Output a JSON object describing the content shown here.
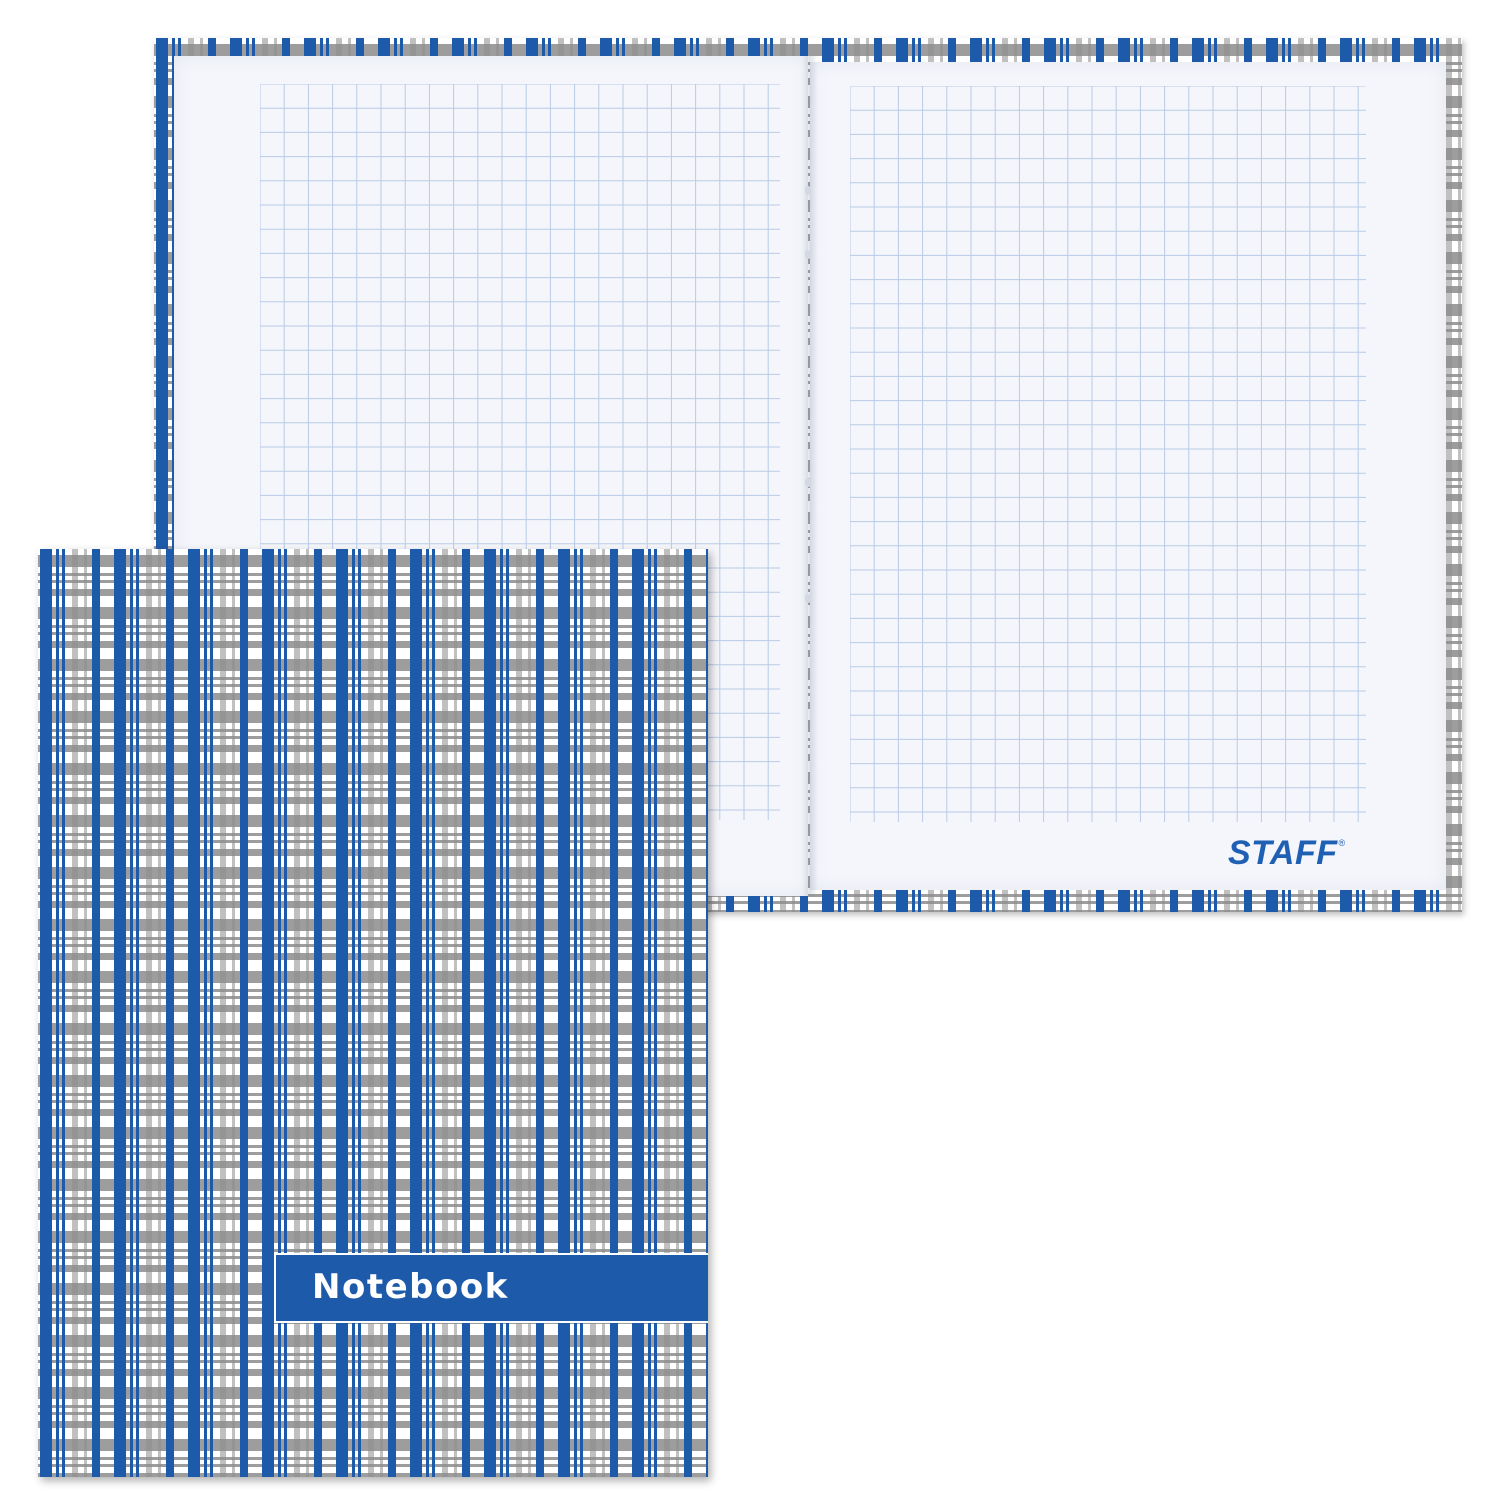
{
  "product": {
    "cover_title": "Notebook",
    "brand": "STAFF",
    "brand_mark": "®"
  },
  "colors": {
    "plaid_blue": "#1e5aaa",
    "plaid_gray": "#8c8c8c",
    "page_white": "#f4f6fb",
    "grid_line": "#b9cbe6",
    "logo_blue": "#2060b4"
  },
  "pages": {
    "ruling": "square-grid"
  }
}
